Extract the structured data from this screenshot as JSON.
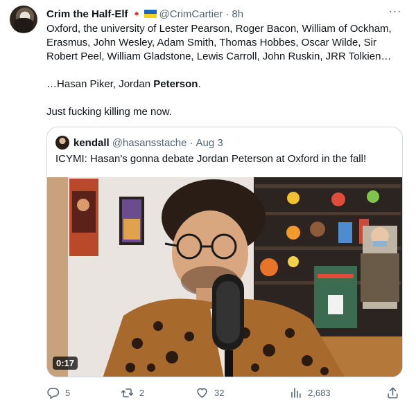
{
  "tweet": {
    "display_name": "Crim the Half-Elf",
    "handle": "@CrimCartier",
    "separator": "·",
    "time": "8h",
    "more": "···",
    "lines": [
      "Oxford, the university of Lester Pearson, Roger Bacon, William of Ockham,",
      "Erasmus, John Wesley, Adam Smith, Thomas Hobbes, Oscar Wilde, Sir",
      "Robert Peel, William Gladstone, Lewis Carroll, John Ruskin, JRR Tolkien…"
    ],
    "line4_prefix": "…Hasan Piker, Jordan ",
    "line4_bold": "Peterson",
    "line4_suffix": ".",
    "line5": "Just fucking killing me now.",
    "flags": [
      "canada-flag-icon",
      "ukraine-flag-icon"
    ]
  },
  "quote": {
    "display_name": "kendall",
    "handle": "@hasansstache",
    "separator": "·",
    "date": "Aug 3",
    "text": "ICYMI: Hasan's gonna debate Jordan Peterson at Oxford in the fall!",
    "video_duration": "0:17"
  },
  "actions": {
    "replies": "5",
    "retweets": "2",
    "likes": "32",
    "views": "2,683"
  },
  "colors": {
    "text": "#0f1419",
    "secondary": "#536471",
    "border": "#cfd9de"
  }
}
